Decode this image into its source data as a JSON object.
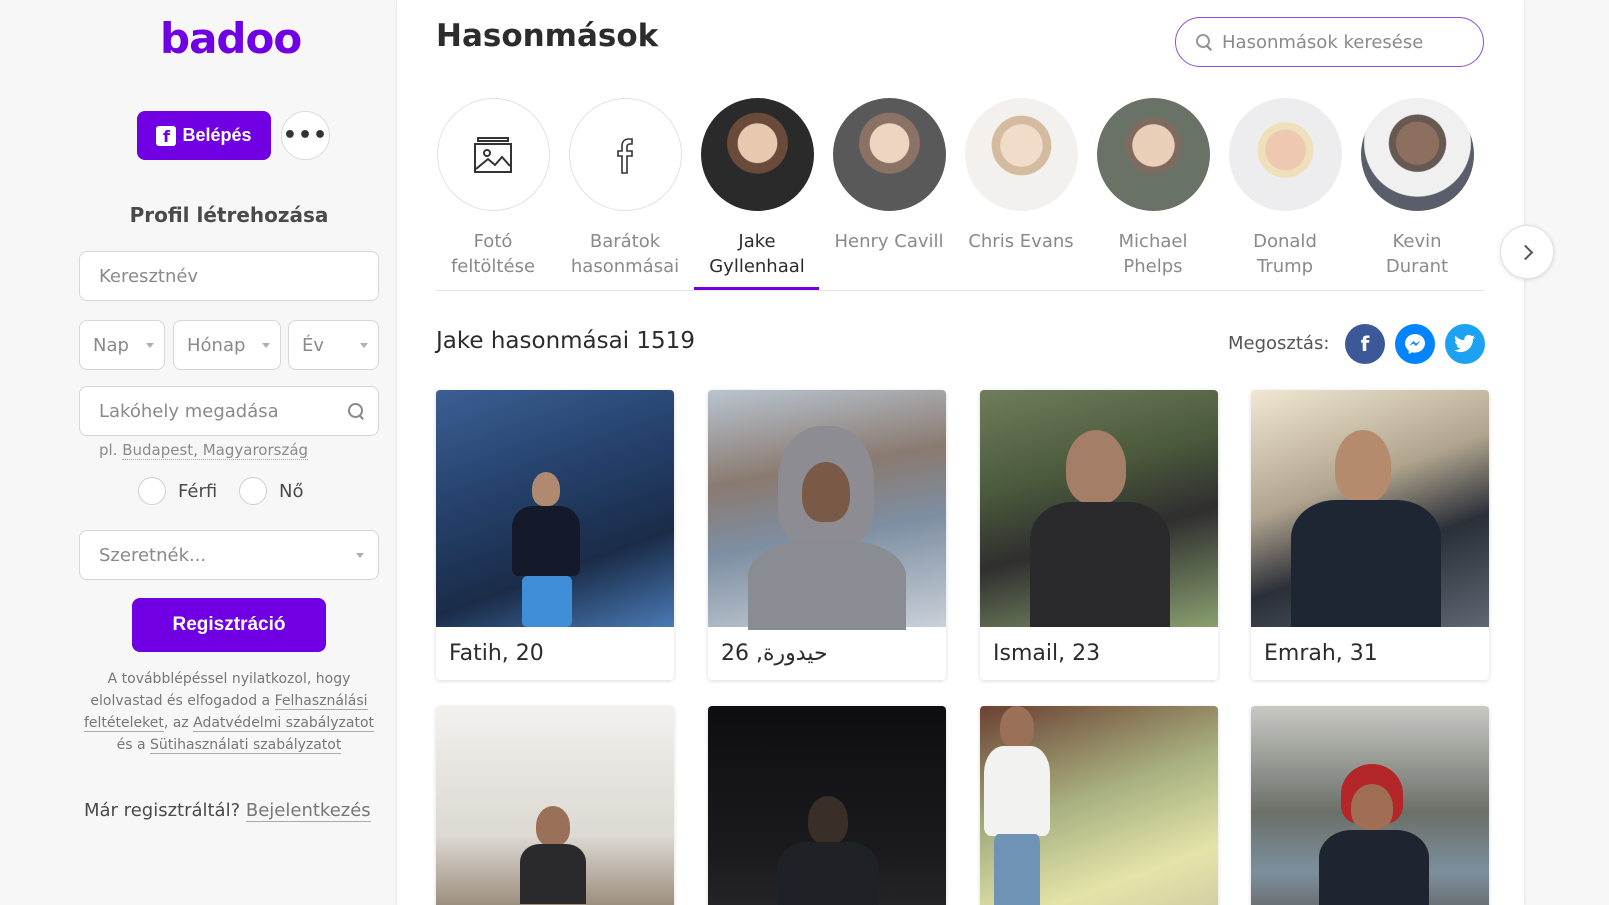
{
  "brand": {
    "logo": "badoo",
    "accent": "#7000e3"
  },
  "sidebar": {
    "fb_login_label": "Belépés",
    "fb_glyph": "f",
    "more_label": "•••",
    "profile_title": "Profil létrehozása",
    "firstname_placeholder": "Keresztnév",
    "day_placeholder": "Nap",
    "month_placeholder": "Hónap",
    "year_placeholder": "Év",
    "city_placeholder": "Lakóhely megadása",
    "city_hint_prefix": "pl. ",
    "city_hint_example": "Budapest, Magyarország",
    "gender_male": "Férfi",
    "gender_female": "Nő",
    "want_placeholder": "Szeretnék...",
    "register_label": "Regisztráció",
    "legal_1": "A továbblépéssel nyilatkozol, hogy elolvastad és elfogadod a ",
    "legal_link_terms": "Felhasználási feltételeket",
    "legal_2": ", az ",
    "legal_link_privacy": "Adatvédelmi szabályzatot",
    "legal_3": " és a ",
    "legal_link_cookies": "Sütihasználati szabályzatot",
    "already_text": "Már regisztráltál? ",
    "login_link": "Bejelentkezés"
  },
  "main": {
    "title": "Hasonmások",
    "search_placeholder": "Hasonmások keresése",
    "celebs": [
      {
        "line1": "Fotó",
        "line2": "feltöltése",
        "icon": "image-upload-icon"
      },
      {
        "line1": "Barátok",
        "line2": "hasonmásai",
        "icon": "facebook-icon"
      },
      {
        "line1": "Jake",
        "line2": "Gyllenhaal",
        "icon": ""
      },
      {
        "line1": "Henry Cavill",
        "line2": "",
        "icon": ""
      },
      {
        "line1": "Chris Evans",
        "line2": "",
        "icon": ""
      },
      {
        "line1": "Michael",
        "line2": "Phelps",
        "icon": ""
      },
      {
        "line1": "Donald",
        "line2": "Trump",
        "icon": ""
      },
      {
        "line1": "Kevin",
        "line2": "Durant",
        "icon": ""
      }
    ],
    "active_celeb_index": 2,
    "results_title": "Jake hasonmásai 1519",
    "share_label": "Megosztás:",
    "share_icons": [
      "facebook-icon",
      "messenger-icon",
      "twitter-icon"
    ],
    "cards": [
      {
        "caption": "Fatih, 20"
      },
      {
        "caption": "حيدورة, 26"
      },
      {
        "caption": "Ismail, 23"
      },
      {
        "caption": "Emrah, 31"
      },
      {
        "caption": ""
      },
      {
        "caption": ""
      },
      {
        "caption": ""
      },
      {
        "caption": ""
      }
    ]
  }
}
